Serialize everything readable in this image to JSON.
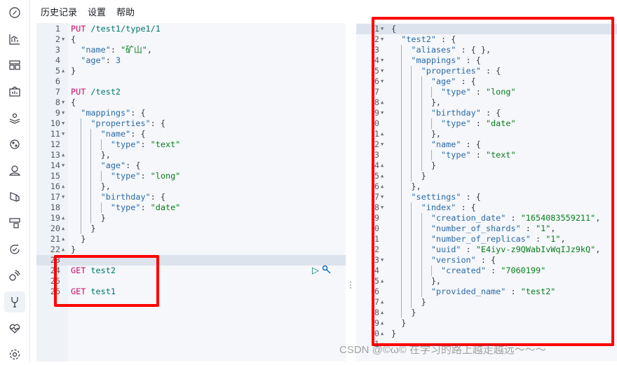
{
  "sidebar": {
    "items": [
      {
        "icon": "compass-icon",
        "label": "Discover"
      },
      {
        "icon": "chart-icon",
        "label": "Visualize"
      },
      {
        "icon": "dashboard-icon",
        "label": "Dashboard"
      },
      {
        "icon": "canvas-icon",
        "label": "Canvas"
      },
      {
        "icon": "maps-icon",
        "label": "Maps"
      },
      {
        "icon": "ml-icon",
        "label": "Machine Learning"
      },
      {
        "icon": "apm-icon",
        "label": "APM"
      },
      {
        "icon": "logs-icon",
        "label": "Logs"
      },
      {
        "icon": "infra-icon",
        "label": "Infrastructure"
      },
      {
        "icon": "uptime-icon",
        "label": "Uptime"
      },
      {
        "icon": "siem-icon",
        "label": "SIEM"
      },
      {
        "icon": "dev-tools-icon",
        "label": "Dev Tools",
        "active": true
      },
      {
        "icon": "monitoring-icon",
        "label": "Monitoring"
      },
      {
        "icon": "gear-icon",
        "label": "Management"
      }
    ]
  },
  "menu": {
    "history": "历史记录",
    "settings": "设置",
    "help": "帮助"
  },
  "request_editor": {
    "highlight_line": 23,
    "lines": [
      {
        "fold": "",
        "tokens": [
          [
            "method",
            "PUT"
          ],
          [
            "p",
            " "
          ],
          [
            "url",
            "/test1/type1/1"
          ]
        ]
      },
      {
        "fold": "open",
        "tokens": [
          [
            "p",
            "{"
          ]
        ]
      },
      {
        "fold": "",
        "tokens": [
          [
            "p",
            "  "
          ],
          [
            "key",
            "\"name\""
          ],
          [
            "p",
            ": "
          ],
          [
            "str",
            "\"矿山\""
          ],
          [
            "p",
            ","
          ]
        ]
      },
      {
        "fold": "",
        "tokens": [
          [
            "p",
            "  "
          ],
          [
            "key",
            "\"age\""
          ],
          [
            "p",
            ": "
          ],
          [
            "num",
            "3"
          ]
        ]
      },
      {
        "fold": "close",
        "tokens": [
          [
            "p",
            "}"
          ]
        ]
      },
      {
        "fold": "",
        "tokens": []
      },
      {
        "fold": "",
        "tokens": [
          [
            "method",
            "PUT"
          ],
          [
            "p",
            " "
          ],
          [
            "url",
            "/test2"
          ]
        ]
      },
      {
        "fold": "open",
        "tokens": [
          [
            "p",
            "{"
          ]
        ]
      },
      {
        "fold": "open",
        "tokens": [
          [
            "p",
            "  "
          ],
          [
            "key",
            "\"mappings\""
          ],
          [
            "p",
            ": {"
          ]
        ]
      },
      {
        "fold": "open",
        "tokens": [
          [
            "p",
            "    "
          ],
          [
            "key",
            "\"properties\""
          ],
          [
            "p",
            ": {"
          ]
        ]
      },
      {
        "fold": "open",
        "tokens": [
          [
            "p",
            "      "
          ],
          [
            "key",
            "\"name\""
          ],
          [
            "p",
            ": {"
          ]
        ]
      },
      {
        "fold": "",
        "tokens": [
          [
            "p",
            "        "
          ],
          [
            "key",
            "\"type\""
          ],
          [
            "p",
            ": "
          ],
          [
            "str",
            "\"text\""
          ]
        ]
      },
      {
        "fold": "close",
        "tokens": [
          [
            "p",
            "      },"
          ]
        ]
      },
      {
        "fold": "open",
        "tokens": [
          [
            "p",
            "      "
          ],
          [
            "key",
            "\"age\""
          ],
          [
            "p",
            ": {"
          ]
        ]
      },
      {
        "fold": "",
        "tokens": [
          [
            "p",
            "        "
          ],
          [
            "key",
            "\"type\""
          ],
          [
            "p",
            ": "
          ],
          [
            "str",
            "\"long\""
          ]
        ]
      },
      {
        "fold": "close",
        "tokens": [
          [
            "p",
            "      },"
          ]
        ]
      },
      {
        "fold": "open",
        "tokens": [
          [
            "p",
            "      "
          ],
          [
            "key",
            "\"birthday\""
          ],
          [
            "p",
            ": {"
          ]
        ]
      },
      {
        "fold": "",
        "tokens": [
          [
            "p",
            "        "
          ],
          [
            "key",
            "\"type\""
          ],
          [
            "p",
            ": "
          ],
          [
            "str",
            "\"date\""
          ]
        ]
      },
      {
        "fold": "close",
        "tokens": [
          [
            "p",
            "      }"
          ]
        ]
      },
      {
        "fold": "close",
        "tokens": [
          [
            "p",
            "    }"
          ]
        ]
      },
      {
        "fold": "close",
        "tokens": [
          [
            "p",
            "  }"
          ]
        ]
      },
      {
        "fold": "close",
        "tokens": [
          [
            "p",
            "}"
          ]
        ]
      },
      {
        "fold": "",
        "tokens": []
      },
      {
        "fold": "",
        "tokens": [
          [
            "method",
            "GET"
          ],
          [
            "p",
            " "
          ],
          [
            "url",
            "test2"
          ]
        ]
      },
      {
        "fold": "",
        "tokens": []
      },
      {
        "fold": "",
        "tokens": [
          [
            "method",
            "GET"
          ],
          [
            "p",
            " "
          ],
          [
            "url",
            "test1"
          ]
        ]
      }
    ],
    "actions": {
      "run": "▷",
      "wrench": "🔧"
    }
  },
  "response_viewer": {
    "highlight_line": 1,
    "lines": [
      {
        "fold": "open",
        "tokens": [
          [
            "p",
            "{"
          ]
        ]
      },
      {
        "fold": "open",
        "tokens": [
          [
            "p",
            "  "
          ],
          [
            "key",
            "\"test2\""
          ],
          [
            "p",
            " : {"
          ]
        ]
      },
      {
        "fold": "",
        "tokens": [
          [
            "p",
            "    "
          ],
          [
            "key",
            "\"aliases\""
          ],
          [
            "p",
            " : { },"
          ]
        ]
      },
      {
        "fold": "open",
        "tokens": [
          [
            "p",
            "    "
          ],
          [
            "key",
            "\"mappings\""
          ],
          [
            "p",
            " : {"
          ]
        ]
      },
      {
        "fold": "open",
        "tokens": [
          [
            "p",
            "      "
          ],
          [
            "key",
            "\"properties\""
          ],
          [
            "p",
            " : {"
          ]
        ]
      },
      {
        "fold": "open",
        "tokens": [
          [
            "p",
            "        "
          ],
          [
            "key",
            "\"age\""
          ],
          [
            "p",
            " : {"
          ]
        ]
      },
      {
        "fold": "",
        "tokens": [
          [
            "p",
            "          "
          ],
          [
            "key",
            "\"type\""
          ],
          [
            "p",
            " : "
          ],
          [
            "str",
            "\"long\""
          ]
        ]
      },
      {
        "fold": "close",
        "tokens": [
          [
            "p",
            "        },"
          ]
        ]
      },
      {
        "fold": "open",
        "tokens": [
          [
            "p",
            "        "
          ],
          [
            "key",
            "\"birthday\""
          ],
          [
            "p",
            " : {"
          ]
        ]
      },
      {
        "fold": "",
        "tokens": [
          [
            "p",
            "          "
          ],
          [
            "key",
            "\"type\""
          ],
          [
            "p",
            " : "
          ],
          [
            "str",
            "\"date\""
          ]
        ]
      },
      {
        "fold": "close",
        "tokens": [
          [
            "p",
            "        },"
          ]
        ]
      },
      {
        "fold": "open",
        "tokens": [
          [
            "p",
            "        "
          ],
          [
            "key",
            "\"name\""
          ],
          [
            "p",
            " : {"
          ]
        ]
      },
      {
        "fold": "",
        "tokens": [
          [
            "p",
            "          "
          ],
          [
            "key",
            "\"type\""
          ],
          [
            "p",
            " : "
          ],
          [
            "str",
            "\"text\""
          ]
        ]
      },
      {
        "fold": "close",
        "tokens": [
          [
            "p",
            "        }"
          ]
        ]
      },
      {
        "fold": "close",
        "tokens": [
          [
            "p",
            "      }"
          ]
        ]
      },
      {
        "fold": "close",
        "tokens": [
          [
            "p",
            "    },"
          ]
        ]
      },
      {
        "fold": "open",
        "tokens": [
          [
            "p",
            "    "
          ],
          [
            "key",
            "\"settings\""
          ],
          [
            "p",
            " : {"
          ]
        ]
      },
      {
        "fold": "open",
        "tokens": [
          [
            "p",
            "      "
          ],
          [
            "key",
            "\"index\""
          ],
          [
            "p",
            " : {"
          ]
        ]
      },
      {
        "fold": "",
        "tokens": [
          [
            "p",
            "        "
          ],
          [
            "key",
            "\"creation_date\""
          ],
          [
            "p",
            " : "
          ],
          [
            "str",
            "\"1654083559211\""
          ],
          [
            "p",
            ","
          ]
        ]
      },
      {
        "fold": "",
        "tokens": [
          [
            "p",
            "        "
          ],
          [
            "key",
            "\"number_of_shards\""
          ],
          [
            "p",
            " : "
          ],
          [
            "str",
            "\"1\""
          ],
          [
            "p",
            ","
          ]
        ]
      },
      {
        "fold": "",
        "tokens": [
          [
            "p",
            "        "
          ],
          [
            "key",
            "\"number_of_replicas\""
          ],
          [
            "p",
            " : "
          ],
          [
            "str",
            "\"1\""
          ],
          [
            "p",
            ","
          ]
        ]
      },
      {
        "fold": "",
        "tokens": [
          [
            "p",
            "        "
          ],
          [
            "key",
            "\"uuid\""
          ],
          [
            "p",
            " : "
          ],
          [
            "str",
            "\"E4iyv-z9QWabIvWqIJz9kQ\""
          ],
          [
            "p",
            ","
          ]
        ]
      },
      {
        "fold": "open",
        "tokens": [
          [
            "p",
            "        "
          ],
          [
            "key",
            "\"version\""
          ],
          [
            "p",
            " : {"
          ]
        ]
      },
      {
        "fold": "",
        "tokens": [
          [
            "p",
            "          "
          ],
          [
            "key",
            "\"created\""
          ],
          [
            "p",
            " : "
          ],
          [
            "str",
            "\"7060199\""
          ]
        ]
      },
      {
        "fold": "close",
        "tokens": [
          [
            "p",
            "        },"
          ]
        ]
      },
      {
        "fold": "",
        "tokens": [
          [
            "p",
            "        "
          ],
          [
            "key",
            "\"provided_name\""
          ],
          [
            "p",
            " : "
          ],
          [
            "str",
            "\"test2\""
          ]
        ]
      },
      {
        "fold": "close",
        "tokens": [
          [
            "p",
            "      }"
          ]
        ]
      },
      {
        "fold": "close",
        "tokens": [
          [
            "p",
            "    }"
          ]
        ]
      },
      {
        "fold": "close",
        "tokens": [
          [
            "p",
            "  }"
          ]
        ]
      },
      {
        "fold": "close",
        "tokens": [
          [
            "p",
            "}"
          ]
        ]
      },
      {
        "fold": "",
        "tokens": []
      }
    ]
  },
  "annotation_color": "#ff0000",
  "watermark": "CSDN @©ω© 在学习的路上越走越远～～～"
}
